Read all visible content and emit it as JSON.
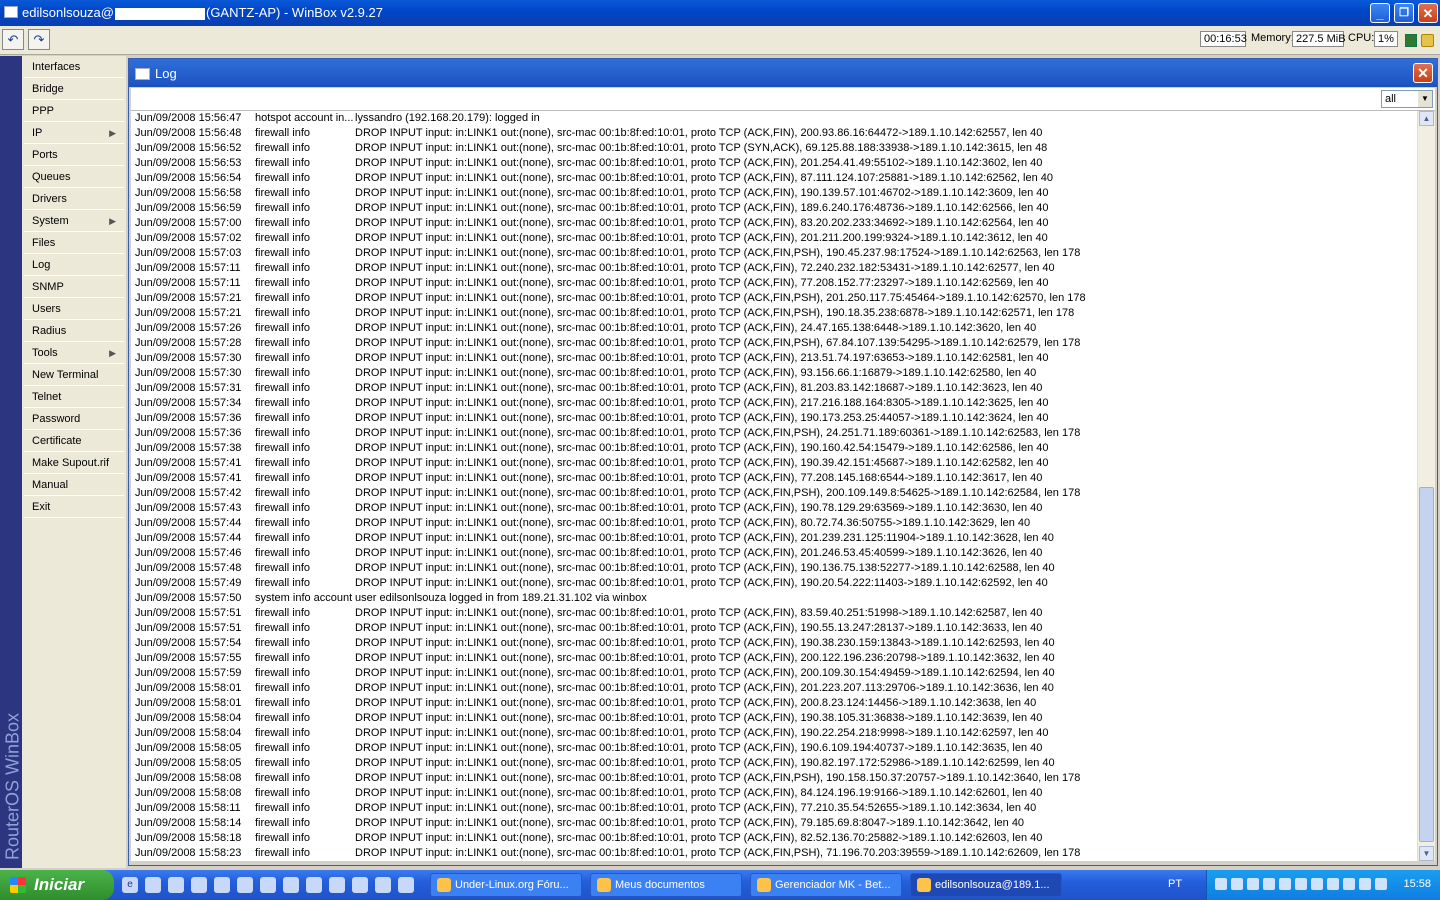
{
  "window": {
    "title_prefix": "edilsonlsouza@",
    "title_suffix": "(GANTZ-AP) - WinBox v2.9.27",
    "minimize": "_",
    "maximize": "❐",
    "close": "✕"
  },
  "toolbar": {
    "undo": "↶",
    "redo": "↷",
    "uptime": "00:16:53",
    "memory_label": "Memory:",
    "memory": "227.5 MiB",
    "cpu_label": "CPU:",
    "cpu": "1%"
  },
  "brand": "RouterOS WinBox",
  "menu": [
    {
      "label": "Interfaces",
      "sub": false
    },
    {
      "label": "Bridge",
      "sub": false
    },
    {
      "label": "PPP",
      "sub": false
    },
    {
      "label": "IP",
      "sub": true
    },
    {
      "label": "Ports",
      "sub": false
    },
    {
      "label": "Queues",
      "sub": false
    },
    {
      "label": "Drivers",
      "sub": false
    },
    {
      "label": "System",
      "sub": true
    },
    {
      "label": "Files",
      "sub": false
    },
    {
      "label": "Log",
      "sub": false
    },
    {
      "label": "SNMP",
      "sub": false
    },
    {
      "label": "Users",
      "sub": false
    },
    {
      "label": "Radius",
      "sub": false
    },
    {
      "label": "Tools",
      "sub": true
    },
    {
      "label": "New Terminal",
      "sub": false
    },
    {
      "label": "Telnet",
      "sub": false
    },
    {
      "label": "Password",
      "sub": false
    },
    {
      "label": "Certificate",
      "sub": false
    },
    {
      "label": "Make Supout.rif",
      "sub": false
    },
    {
      "label": "Manual",
      "sub": false
    },
    {
      "label": "Exit",
      "sub": false
    }
  ],
  "menu_arrow": "▶",
  "log": {
    "title": "Log",
    "close": "✕",
    "filter": "all",
    "filter_arrow": "▼",
    "scroll_up": "▲",
    "scroll_down": "▼",
    "rows": [
      [
        "Jun/09/2008 15:56:47",
        "hotspot account in...",
        "lyssandro (192.168.20.179): logged in"
      ],
      [
        "Jun/09/2008 15:56:48",
        "firewall info",
        "DROP INPUT input: in:LINK1 out:(none), src-mac 00:1b:8f:ed:10:01, proto TCP (ACK,FIN), 200.93.86.16:64472->189.1.10.142:62557, len 40"
      ],
      [
        "Jun/09/2008 15:56:52",
        "firewall info",
        "DROP INPUT input: in:LINK1 out:(none), src-mac 00:1b:8f:ed:10:01, proto TCP (SYN,ACK), 69.125.88.188:33938->189.1.10.142:3615, len 48"
      ],
      [
        "Jun/09/2008 15:56:53",
        "firewall info",
        "DROP INPUT input: in:LINK1 out:(none), src-mac 00:1b:8f:ed:10:01, proto TCP (ACK,FIN), 201.254.41.49:55102->189.1.10.142:3602, len 40"
      ],
      [
        "Jun/09/2008 15:56:54",
        "firewall info",
        "DROP INPUT input: in:LINK1 out:(none), src-mac 00:1b:8f:ed:10:01, proto TCP (ACK,FIN), 87.111.124.107:25881->189.1.10.142:62562, len 40"
      ],
      [
        "Jun/09/2008 15:56:58",
        "firewall info",
        "DROP INPUT input: in:LINK1 out:(none), src-mac 00:1b:8f:ed:10:01, proto TCP (ACK,FIN), 190.139.57.101:46702->189.1.10.142:3609, len 40"
      ],
      [
        "Jun/09/2008 15:56:59",
        "firewall info",
        "DROP INPUT input: in:LINK1 out:(none), src-mac 00:1b:8f:ed:10:01, proto TCP (ACK,FIN), 189.6.240.176:48736->189.1.10.142:62566, len 40"
      ],
      [
        "Jun/09/2008 15:57:00",
        "firewall info",
        "DROP INPUT input: in:LINK1 out:(none), src-mac 00:1b:8f:ed:10:01, proto TCP (ACK,FIN), 83.20.202.233:34692->189.1.10.142:62564, len 40"
      ],
      [
        "Jun/09/2008 15:57:02",
        "firewall info",
        "DROP INPUT input: in:LINK1 out:(none), src-mac 00:1b:8f:ed:10:01, proto TCP (ACK,FIN), 201.211.200.199:9324->189.1.10.142:3612, len 40"
      ],
      [
        "Jun/09/2008 15:57:03",
        "firewall info",
        "DROP INPUT input: in:LINK1 out:(none), src-mac 00:1b:8f:ed:10:01, proto TCP (ACK,FIN,PSH), 190.45.237.98:17524->189.1.10.142:62563, len 178"
      ],
      [
        "Jun/09/2008 15:57:11",
        "firewall info",
        "DROP INPUT input: in:LINK1 out:(none), src-mac 00:1b:8f:ed:10:01, proto TCP (ACK,FIN), 72.240.232.182:53431->189.1.10.142:62577, len 40"
      ],
      [
        "Jun/09/2008 15:57:11",
        "firewall info",
        "DROP INPUT input: in:LINK1 out:(none), src-mac 00:1b:8f:ed:10:01, proto TCP (ACK,FIN), 77.208.152.77:23297->189.1.10.142:62569, len 40"
      ],
      [
        "Jun/09/2008 15:57:21",
        "firewall info",
        "DROP INPUT input: in:LINK1 out:(none), src-mac 00:1b:8f:ed:10:01, proto TCP (ACK,FIN,PSH), 201.250.117.75:45464->189.1.10.142:62570, len 178"
      ],
      [
        "Jun/09/2008 15:57:21",
        "firewall info",
        "DROP INPUT input: in:LINK1 out:(none), src-mac 00:1b:8f:ed:10:01, proto TCP (ACK,FIN,PSH), 190.18.35.238:6878->189.1.10.142:62571, len 178"
      ],
      [
        "Jun/09/2008 15:57:26",
        "firewall info",
        "DROP INPUT input: in:LINK1 out:(none), src-mac 00:1b:8f:ed:10:01, proto TCP (ACK,FIN), 24.47.165.138:6448->189.1.10.142:3620, len 40"
      ],
      [
        "Jun/09/2008 15:57:28",
        "firewall info",
        "DROP INPUT input: in:LINK1 out:(none), src-mac 00:1b:8f:ed:10:01, proto TCP (ACK,FIN,PSH), 67.84.107.139:54295->189.1.10.142:62579, len 178"
      ],
      [
        "Jun/09/2008 15:57:30",
        "firewall info",
        "DROP INPUT input: in:LINK1 out:(none), src-mac 00:1b:8f:ed:10:01, proto TCP (ACK,FIN), 213.51.74.197:63653->189.1.10.142:62581, len 40"
      ],
      [
        "Jun/09/2008 15:57:30",
        "firewall info",
        "DROP INPUT input: in:LINK1 out:(none), src-mac 00:1b:8f:ed:10:01, proto TCP (ACK,FIN), 93.156.66.1:16879->189.1.10.142:62580, len 40"
      ],
      [
        "Jun/09/2008 15:57:31",
        "firewall info",
        "DROP INPUT input: in:LINK1 out:(none), src-mac 00:1b:8f:ed:10:01, proto TCP (ACK,FIN), 81.203.83.142:18687->189.1.10.142:3623, len 40"
      ],
      [
        "Jun/09/2008 15:57:34",
        "firewall info",
        "DROP INPUT input: in:LINK1 out:(none), src-mac 00:1b:8f:ed:10:01, proto TCP (ACK,FIN), 217.216.188.164:8305->189.1.10.142:3625, len 40"
      ],
      [
        "Jun/09/2008 15:57:36",
        "firewall info",
        "DROP INPUT input: in:LINK1 out:(none), src-mac 00:1b:8f:ed:10:01, proto TCP (ACK,FIN), 190.173.253.25:44057->189.1.10.142:3624, len 40"
      ],
      [
        "Jun/09/2008 15:57:36",
        "firewall info",
        "DROP INPUT input: in:LINK1 out:(none), src-mac 00:1b:8f:ed:10:01, proto TCP (ACK,FIN,PSH), 24.251.71.189:60361->189.1.10.142:62583, len 178"
      ],
      [
        "Jun/09/2008 15:57:38",
        "firewall info",
        "DROP INPUT input: in:LINK1 out:(none), src-mac 00:1b:8f:ed:10:01, proto TCP (ACK,FIN), 190.160.42.54:15479->189.1.10.142:62586, len 40"
      ],
      [
        "Jun/09/2008 15:57:41",
        "firewall info",
        "DROP INPUT input: in:LINK1 out:(none), src-mac 00:1b:8f:ed:10:01, proto TCP (ACK,FIN), 190.39.42.151:45687->189.1.10.142:62582, len 40"
      ],
      [
        "Jun/09/2008 15:57:41",
        "firewall info",
        "DROP INPUT input: in:LINK1 out:(none), src-mac 00:1b:8f:ed:10:01, proto TCP (ACK,FIN), 77.208.145.168:6544->189.1.10.142:3617, len 40"
      ],
      [
        "Jun/09/2008 15:57:42",
        "firewall info",
        "DROP INPUT input: in:LINK1 out:(none), src-mac 00:1b:8f:ed:10:01, proto TCP (ACK,FIN,PSH), 200.109.149.8:54625->189.1.10.142:62584, len 178"
      ],
      [
        "Jun/09/2008 15:57:43",
        "firewall info",
        "DROP INPUT input: in:LINK1 out:(none), src-mac 00:1b:8f:ed:10:01, proto TCP (ACK,FIN), 190.78.129.29:63569->189.1.10.142:3630, len 40"
      ],
      [
        "Jun/09/2008 15:57:44",
        "firewall info",
        "DROP INPUT input: in:LINK1 out:(none), src-mac 00:1b:8f:ed:10:01, proto TCP (ACK,FIN), 80.72.74.36:50755->189.1.10.142:3629, len 40"
      ],
      [
        "Jun/09/2008 15:57:44",
        "firewall info",
        "DROP INPUT input: in:LINK1 out:(none), src-mac 00:1b:8f:ed:10:01, proto TCP (ACK,FIN), 201.239.231.125:11904->189.1.10.142:3628, len 40"
      ],
      [
        "Jun/09/2008 15:57:46",
        "firewall info",
        "DROP INPUT input: in:LINK1 out:(none), src-mac 00:1b:8f:ed:10:01, proto TCP (ACK,FIN), 201.246.53.45:40599->189.1.10.142:3626, len 40"
      ],
      [
        "Jun/09/2008 15:57:48",
        "firewall info",
        "DROP INPUT input: in:LINK1 out:(none), src-mac 00:1b:8f:ed:10:01, proto TCP (ACK,FIN), 190.136.75.138:52277->189.1.10.142:62588, len 40"
      ],
      [
        "Jun/09/2008 15:57:49",
        "firewall info",
        "DROP INPUT input: in:LINK1 out:(none), src-mac 00:1b:8f:ed:10:01, proto TCP (ACK,FIN), 190.20.54.222:11403->189.1.10.142:62592, len 40"
      ],
      [
        "Jun/09/2008 15:57:50",
        "system info account",
        "user edilsonlsouza logged in from 189.21.31.102 via winbox"
      ],
      [
        "Jun/09/2008 15:57:51",
        "firewall info",
        "DROP INPUT input: in:LINK1 out:(none), src-mac 00:1b:8f:ed:10:01, proto TCP (ACK,FIN), 83.59.40.251:51998->189.1.10.142:62587, len 40"
      ],
      [
        "Jun/09/2008 15:57:51",
        "firewall info",
        "DROP INPUT input: in:LINK1 out:(none), src-mac 00:1b:8f:ed:10:01, proto TCP (ACK,FIN), 190.55.13.247:28137->189.1.10.142:3633, len 40"
      ],
      [
        "Jun/09/2008 15:57:54",
        "firewall info",
        "DROP INPUT input: in:LINK1 out:(none), src-mac 00:1b:8f:ed:10:01, proto TCP (ACK,FIN), 190.38.230.159:13843->189.1.10.142:62593, len 40"
      ],
      [
        "Jun/09/2008 15:57:55",
        "firewall info",
        "DROP INPUT input: in:LINK1 out:(none), src-mac 00:1b:8f:ed:10:01, proto TCP (ACK,FIN), 200.122.196.236:20798->189.1.10.142:3632, len 40"
      ],
      [
        "Jun/09/2008 15:57:59",
        "firewall info",
        "DROP INPUT input: in:LINK1 out:(none), src-mac 00:1b:8f:ed:10:01, proto TCP (ACK,FIN), 200.109.30.154:49459->189.1.10.142:62594, len 40"
      ],
      [
        "Jun/09/2008 15:58:01",
        "firewall info",
        "DROP INPUT input: in:LINK1 out:(none), src-mac 00:1b:8f:ed:10:01, proto TCP (ACK,FIN), 201.223.207.113:29706->189.1.10.142:3636, len 40"
      ],
      [
        "Jun/09/2008 15:58:01",
        "firewall info",
        "DROP INPUT input: in:LINK1 out:(none), src-mac 00:1b:8f:ed:10:01, proto TCP (ACK,FIN), 200.8.23.124:14456->189.1.10.142:3638, len 40"
      ],
      [
        "Jun/09/2008 15:58:04",
        "firewall info",
        "DROP INPUT input: in:LINK1 out:(none), src-mac 00:1b:8f:ed:10:01, proto TCP (ACK,FIN), 190.38.105.31:36838->189.1.10.142:3639, len 40"
      ],
      [
        "Jun/09/2008 15:58:04",
        "firewall info",
        "DROP INPUT input: in:LINK1 out:(none), src-mac 00:1b:8f:ed:10:01, proto TCP (ACK,FIN), 190.22.254.218:9998->189.1.10.142:62597, len 40"
      ],
      [
        "Jun/09/2008 15:58:05",
        "firewall info",
        "DROP INPUT input: in:LINK1 out:(none), src-mac 00:1b:8f:ed:10:01, proto TCP (ACK,FIN), 190.6.109.194:40737->189.1.10.142:3635, len 40"
      ],
      [
        "Jun/09/2008 15:58:05",
        "firewall info",
        "DROP INPUT input: in:LINK1 out:(none), src-mac 00:1b:8f:ed:10:01, proto TCP (ACK,FIN), 190.82.197.172:52986->189.1.10.142:62599, len 40"
      ],
      [
        "Jun/09/2008 15:58:08",
        "firewall info",
        "DROP INPUT input: in:LINK1 out:(none), src-mac 00:1b:8f:ed:10:01, proto TCP (ACK,FIN,PSH), 190.158.150.37:20757->189.1.10.142:3640, len 178"
      ],
      [
        "Jun/09/2008 15:58:08",
        "firewall info",
        "DROP INPUT input: in:LINK1 out:(none), src-mac 00:1b:8f:ed:10:01, proto TCP (ACK,FIN), 84.124.196.19:9166->189.1.10.142:62601, len 40"
      ],
      [
        "Jun/09/2008 15:58:11",
        "firewall info",
        "DROP INPUT input: in:LINK1 out:(none), src-mac 00:1b:8f:ed:10:01, proto TCP (ACK,FIN), 77.210.35.54:52655->189.1.10.142:3634, len 40"
      ],
      [
        "Jun/09/2008 15:58:14",
        "firewall info",
        "DROP INPUT input: in:LINK1 out:(none), src-mac 00:1b:8f:ed:10:01, proto TCP (ACK,FIN), 79.185.69.8:8047->189.1.10.142:3642, len 40"
      ],
      [
        "Jun/09/2008 15:58:18",
        "firewall info",
        "DROP INPUT input: in:LINK1 out:(none), src-mac 00:1b:8f:ed:10:01, proto TCP (ACK,FIN), 82.52.136.70:25882->189.1.10.142:62603, len 40"
      ],
      [
        "Jun/09/2008 15:58:23",
        "firewall info",
        "DROP INPUT input: in:LINK1 out:(none), src-mac 00:1b:8f:ed:10:01, proto TCP (ACK,FIN,PSH), 71.196.70.203:39559->189.1.10.142:62609, len 178"
      ]
    ]
  },
  "taskbar": {
    "start": "Iniciar",
    "tasks": [
      {
        "label": "Under-Linux.org Fóru...",
        "active": false
      },
      {
        "label": "Meus documentos",
        "active": false
      },
      {
        "label": "Gerenciador MK - Bet...",
        "active": false
      },
      {
        "label": "edilsonlsouza@189.1...",
        "active": true
      }
    ],
    "language": "PT",
    "clock": "15:58"
  }
}
